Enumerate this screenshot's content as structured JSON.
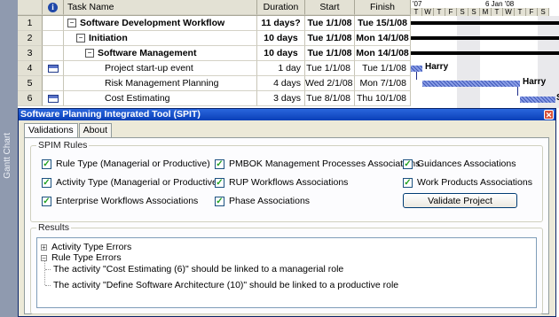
{
  "side_tab": {
    "label": "Gantt Chart"
  },
  "project": {
    "columns": {
      "indicator": "i",
      "name": "Task Name",
      "duration": "Duration",
      "start": "Start",
      "finish": "Finish"
    },
    "rows": [
      {
        "id": "1",
        "name": "Software Development Workflow",
        "duration": "11 days?",
        "start": "Tue 1/1/08",
        "finish": "Tue 15/1/08"
      },
      {
        "id": "2",
        "name": "Initiation",
        "duration": "10 days",
        "start": "Tue 1/1/08",
        "finish": "Mon 14/1/08"
      },
      {
        "id": "3",
        "name": "Software Management",
        "duration": "10 days",
        "start": "Tue 1/1/08",
        "finish": "Mon 14/1/08"
      },
      {
        "id": "4",
        "name": "Project start-up event",
        "duration": "1 day",
        "start": "Tue 1/1/08",
        "finish": "Tue 1/1/08"
      },
      {
        "id": "5",
        "name": "Risk Management Planning",
        "duration": "4 days",
        "start": "Wed 2/1/08",
        "finish": "Mon 7/1/08"
      },
      {
        "id": "6",
        "name": "Cost Estimating",
        "duration": "3 days",
        "start": "Tue 8/1/08",
        "finish": "Thu 10/1/08"
      }
    ],
    "gantt": {
      "week1": "'07",
      "week2": "6 Jan '08",
      "days": [
        "T",
        "W",
        "T",
        "F",
        "S",
        "S",
        "M",
        "T",
        "W",
        "T",
        "F",
        "S"
      ],
      "labels": {
        "row4": "Harry",
        "row5": "Harry",
        "row6": "Sm"
      }
    }
  },
  "dialog": {
    "title": "Software Planning Integrated Tool (SPIT)",
    "close_symbol": "✕",
    "tabs": [
      "Validations",
      "About"
    ],
    "rules": {
      "title": "SPIM Rules",
      "items": [
        {
          "label": "Rule Type (Managerial or Productive)",
          "checked": true
        },
        {
          "label": "PMBOK Management Processes Associations",
          "checked": true
        },
        {
          "label": "Guidances Associations",
          "checked": true
        },
        {
          "label": "Activity Type (Managerial or Productive)",
          "checked": true
        },
        {
          "label": "RUP Workflows Associations",
          "checked": true
        },
        {
          "label": "Work Products Associations",
          "checked": true
        },
        {
          "label": "Enterprise Workflows Associations",
          "checked": true
        },
        {
          "label": "Phase Associations",
          "checked": true
        }
      ],
      "validate_button": "Validate Project"
    },
    "results": {
      "title": "Results",
      "nodes": [
        {
          "label": "Activity Type Errors",
          "expander": "+"
        },
        {
          "label": "Rule Type Errors",
          "expander": "−"
        }
      ],
      "children": [
        "The activity \"Cost Estimating (6)\" should be linked to a managerial role",
        "The activity \"Define Software Architecture (10)\" should be linked to a productive role"
      ]
    }
  }
}
